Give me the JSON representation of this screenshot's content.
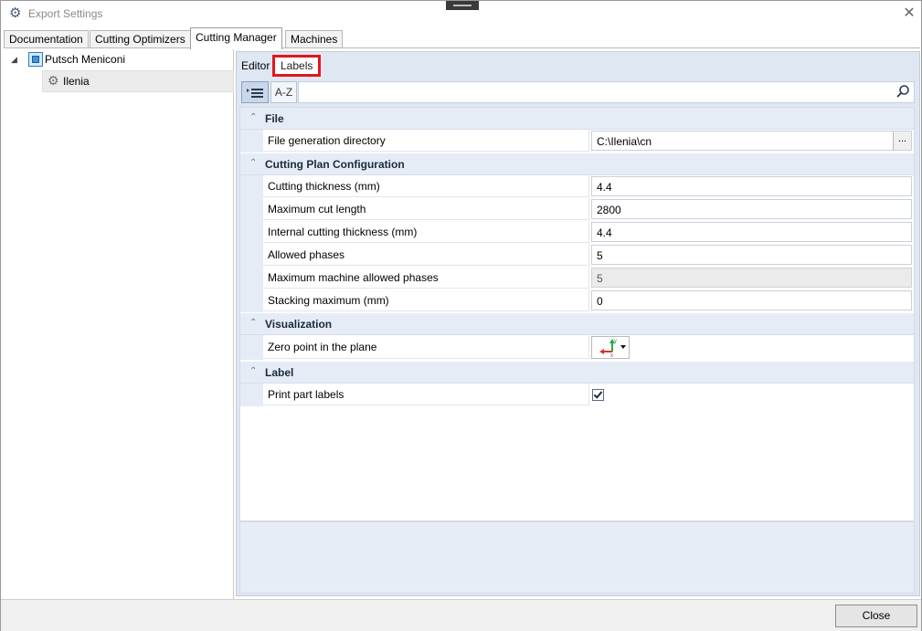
{
  "window": {
    "title": "Export Settings"
  },
  "tabs": [
    "Documentation",
    "Cutting Optimizers",
    "Cutting Manager",
    "Machines"
  ],
  "tree": {
    "root": "Putsch Meniconi",
    "child": "Ilenia"
  },
  "subtabs": {
    "editor": "Editor",
    "labels": "Labels"
  },
  "toolbar": {
    "categorized_icon": "categorized-list-icon",
    "az_label": "A-Z",
    "search_placeholder": ""
  },
  "sections": {
    "file": {
      "title": "File",
      "rows": [
        {
          "name": "File generation directory",
          "value": "C:\\Ilenia\\cn",
          "button": "..."
        }
      ]
    },
    "cutting": {
      "title": "Cutting Plan Configuration",
      "rows": [
        {
          "name": "Cutting thickness (mm)",
          "value": "4.4"
        },
        {
          "name": "Maximum cut length",
          "value": "2800"
        },
        {
          "name": "Internal cutting thickness (mm)",
          "value": "4.4"
        },
        {
          "name": "Allowed phases",
          "value": "5"
        },
        {
          "name": "Maximum machine allowed phases",
          "value": "5"
        },
        {
          "name": "Stacking maximum (mm)",
          "value": "0"
        }
      ]
    },
    "visualization": {
      "title": "Visualization",
      "rows": [
        {
          "name": "Zero point in the plane"
        }
      ]
    },
    "label": {
      "title": "Label",
      "rows": [
        {
          "name": "Print part labels",
          "checked": true
        }
      ]
    }
  },
  "footer": {
    "close_label": "Close"
  },
  "colors": {
    "highlight": "#e2161c",
    "panel": "#dfe7f3",
    "category": "#e6ecf5"
  }
}
